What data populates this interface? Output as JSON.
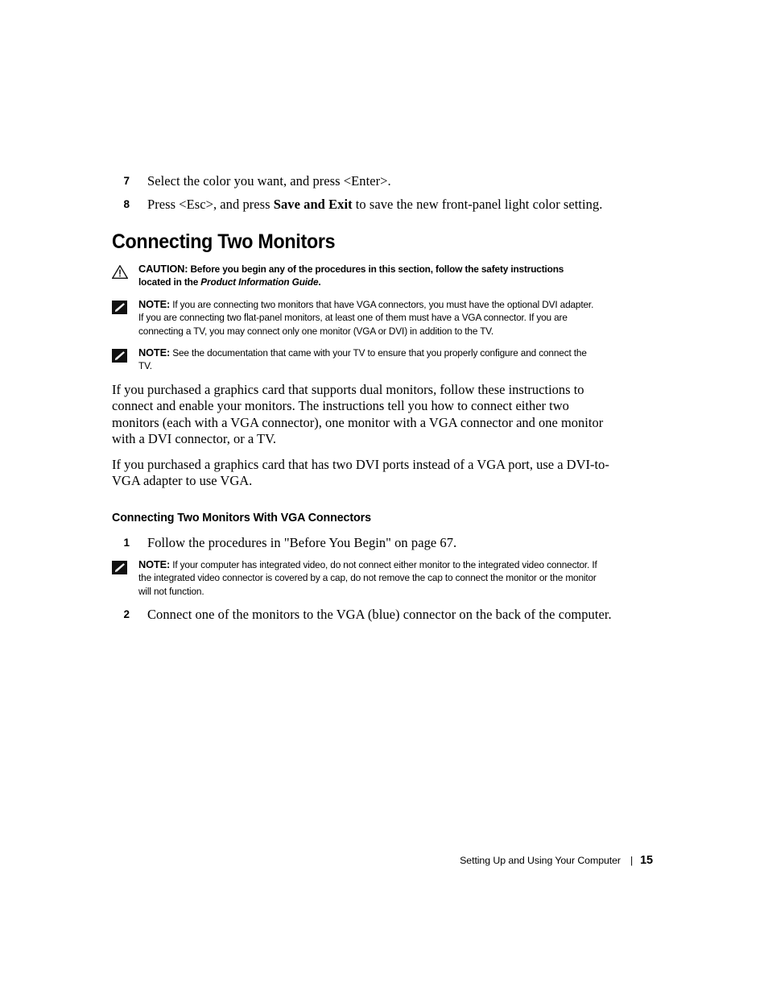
{
  "document": {
    "steps_top": [
      {
        "num": "7",
        "text_before": "Select the color you want, and press <Enter>.",
        "bold": "",
        "text_after": ""
      },
      {
        "num": "8",
        "text_before": "Press <Esc>, and press ",
        "bold": "Save and Exit",
        "text_after": " to save the new front-panel light color setting."
      }
    ],
    "section_title": "Connecting Two Monitors",
    "caution": {
      "icon": "warning-triangle-icon",
      "lead": "CAUTION:",
      "text_before": " Before you begin any of the procedures in this section, follow the safety instructions located in the ",
      "italic": "Product Information Guide",
      "text_after": "."
    },
    "note_1": {
      "icon": "note-pencil-icon",
      "lead": "NOTE:",
      "text": " If you are connecting two monitors that have VGA connectors, you must have the optional DVI adapter. If you are connecting two flat-panel monitors, at least one of them must have a VGA connector. If you are connecting a TV, you may connect only one monitor (VGA or DVI) in addition to the TV."
    },
    "note_2": {
      "icon": "note-pencil-icon",
      "lead": "NOTE:",
      "text": " See the documentation that came with your TV to ensure that you properly configure and connect the TV."
    },
    "paragraph_1": "If you purchased a graphics card that supports dual monitors, follow these instructions to connect and enable your monitors. The instructions tell you how to connect either two monitors (each with a VGA connector), one monitor with a VGA connector and one monitor with a DVI connector, or a TV.",
    "paragraph_2": "If you purchased a graphics card that has two DVI ports instead of a VGA port, use a DVI-to-VGA adapter to use VGA.",
    "sub_title": "Connecting Two Monitors With VGA Connectors",
    "step_1": {
      "num": "1",
      "text": "Follow the procedures in \"Before You Begin\" on page 67."
    },
    "note_3": {
      "icon": "note-pencil-icon",
      "lead": "NOTE:",
      "text": " If your computer has integrated video, do not connect either monitor to the integrated video connector. If the integrated video connector is covered by a cap, do not remove the cap to connect the monitor or the monitor will not function."
    },
    "step_2": {
      "num": "2",
      "text": "Connect one of the monitors to the VGA (blue) connector on the back of the computer."
    },
    "footer": {
      "text": "Setting Up and Using Your Computer",
      "separator": "|",
      "page_number": "15"
    }
  },
  "colors": {
    "text": "#000000",
    "background": "#ffffff"
  }
}
